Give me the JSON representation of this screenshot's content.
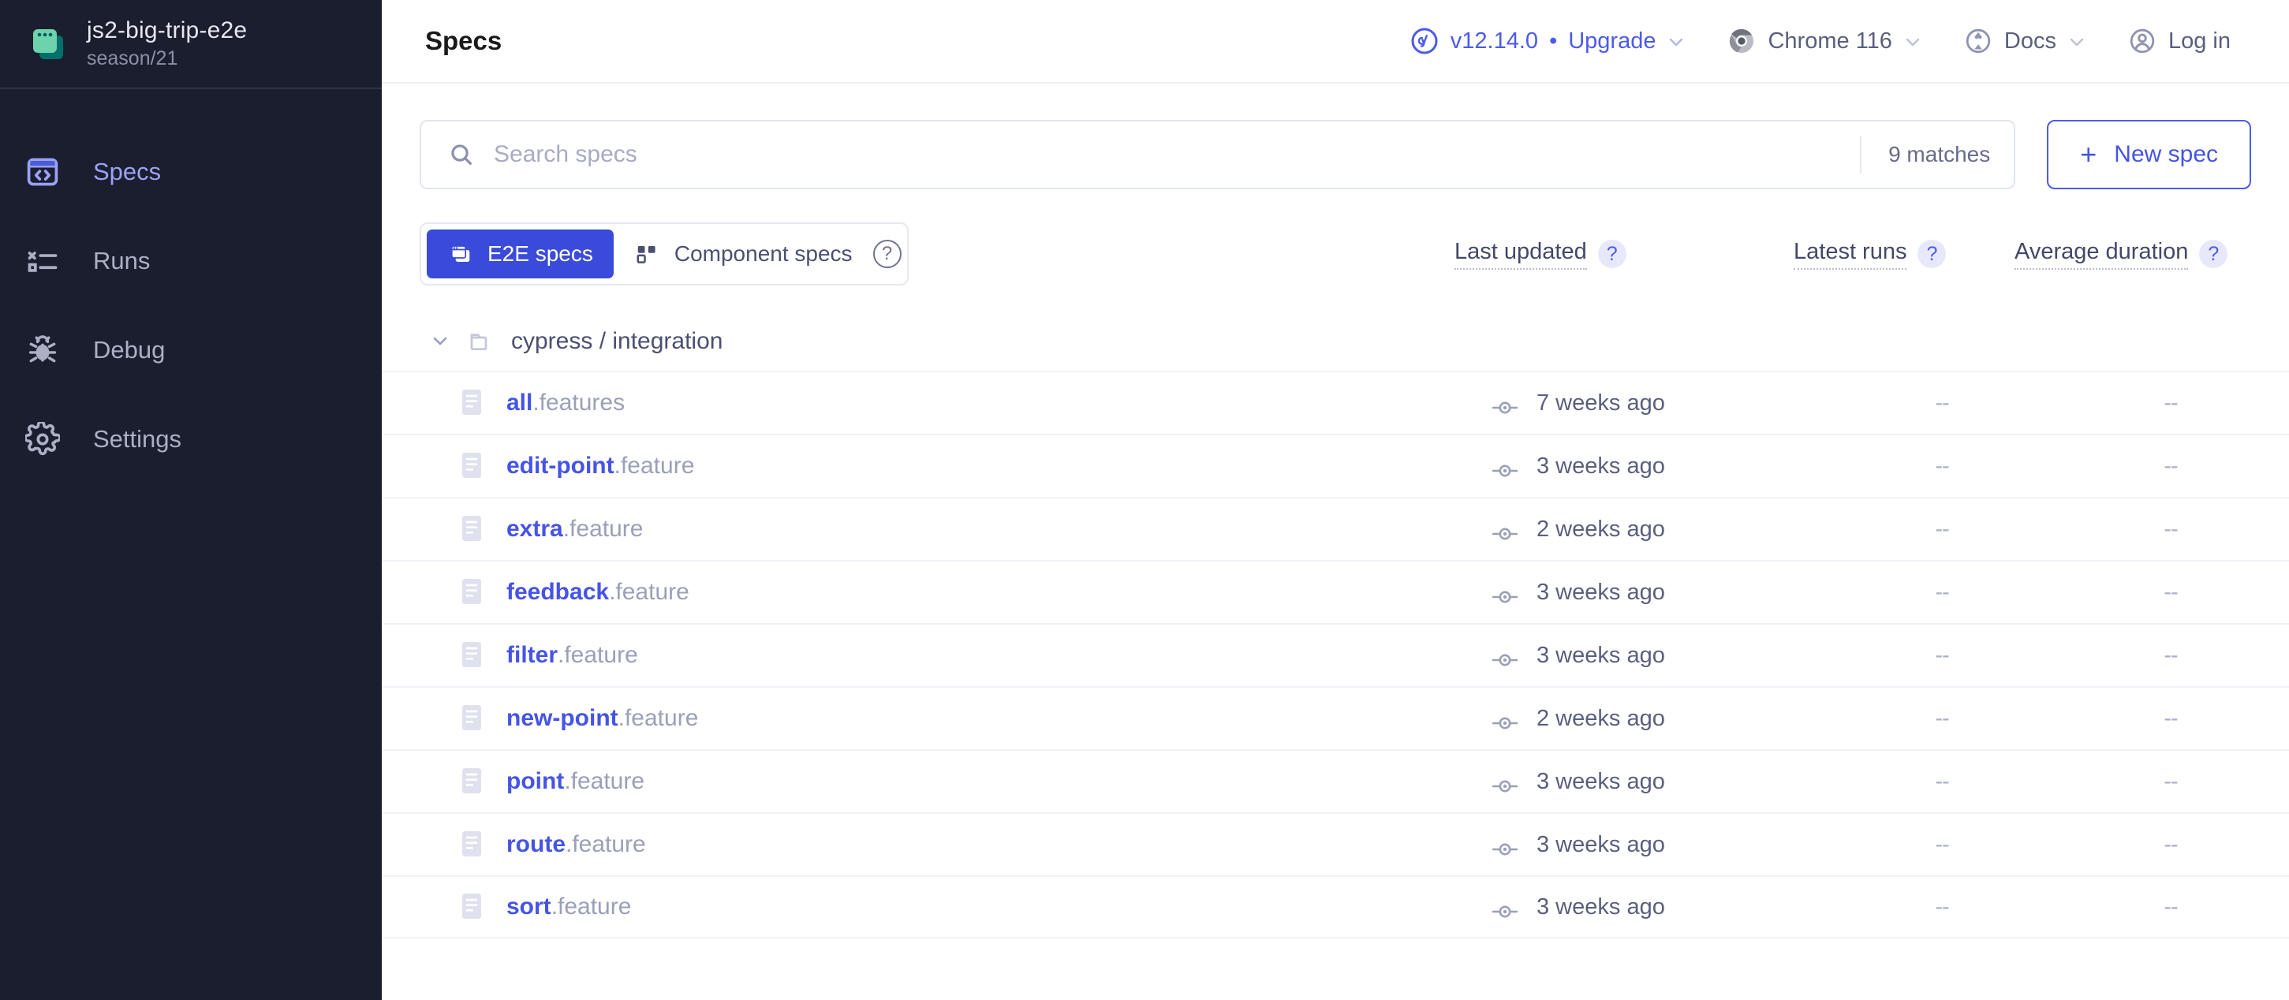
{
  "sidebar": {
    "project": {
      "name": "js2-big-trip-e2e",
      "branch": "season/21",
      "icon": "cypress-project-icon"
    },
    "items": [
      {
        "label": "Specs",
        "icon": "specs-icon",
        "active": true
      },
      {
        "label": "Runs",
        "icon": "runs-icon",
        "active": false
      },
      {
        "label": "Debug",
        "icon": "debug-bug-icon",
        "active": false
      },
      {
        "label": "Settings",
        "icon": "gear-icon",
        "active": false
      }
    ]
  },
  "topbar": {
    "title": "Specs",
    "version": "v12.14.0",
    "separator": "•",
    "upgrade": "Upgrade",
    "browser": "Chrome 116",
    "docs": "Docs",
    "login": "Log in"
  },
  "search": {
    "placeholder": "Search specs",
    "value": "",
    "matches": "9 matches"
  },
  "new_spec": {
    "label": "New spec",
    "plus": "+"
  },
  "tabs": [
    {
      "label": "E2E specs",
      "icon": "e2e-specs-icon",
      "active": true
    },
    {
      "label": "Component specs",
      "icon": "component-specs-icon",
      "active": false
    }
  ],
  "tabs_help": "?",
  "columns": [
    {
      "label": "Last updated",
      "help": "?"
    },
    {
      "label": "Latest runs",
      "help": "?"
    },
    {
      "label": "Average duration",
      "help": "?"
    }
  ],
  "folder": {
    "name": "cypress / integration",
    "expanded": true
  },
  "specs": [
    {
      "base": "all",
      "ext": ".features",
      "last_updated": "7 weeks ago",
      "latest_runs": "--",
      "average_duration": "--"
    },
    {
      "base": "edit-point",
      "ext": ".feature",
      "last_updated": "3 weeks ago",
      "latest_runs": "--",
      "average_duration": "--"
    },
    {
      "base": "extra",
      "ext": ".feature",
      "last_updated": "2 weeks ago",
      "latest_runs": "--",
      "average_duration": "--"
    },
    {
      "base": "feedback",
      "ext": ".feature",
      "last_updated": "3 weeks ago",
      "latest_runs": "--",
      "average_duration": "--"
    },
    {
      "base": "filter",
      "ext": ".feature",
      "last_updated": "3 weeks ago",
      "latest_runs": "--",
      "average_duration": "--"
    },
    {
      "base": "new-point",
      "ext": ".feature",
      "last_updated": "2 weeks ago",
      "latest_runs": "--",
      "average_duration": "--"
    },
    {
      "base": "point",
      "ext": ".feature",
      "last_updated": "3 weeks ago",
      "latest_runs": "--",
      "average_duration": "--"
    },
    {
      "base": "route",
      "ext": ".feature",
      "last_updated": "3 weeks ago",
      "latest_runs": "--",
      "average_duration": "--"
    },
    {
      "base": "sort",
      "ext": ".feature",
      "last_updated": "3 weeks ago",
      "latest_runs": "--",
      "average_duration": "--"
    }
  ],
  "colors": {
    "sidebar_bg": "#1b1e2e",
    "accent_blue": "#4554e6",
    "tab_active_bg": "#3a4bdb",
    "project_icon_green": "#6dd3ac",
    "project_icon_dark": "#00706b",
    "nav_active": "#9ba2f5",
    "muted": "#9aa0b8"
  }
}
